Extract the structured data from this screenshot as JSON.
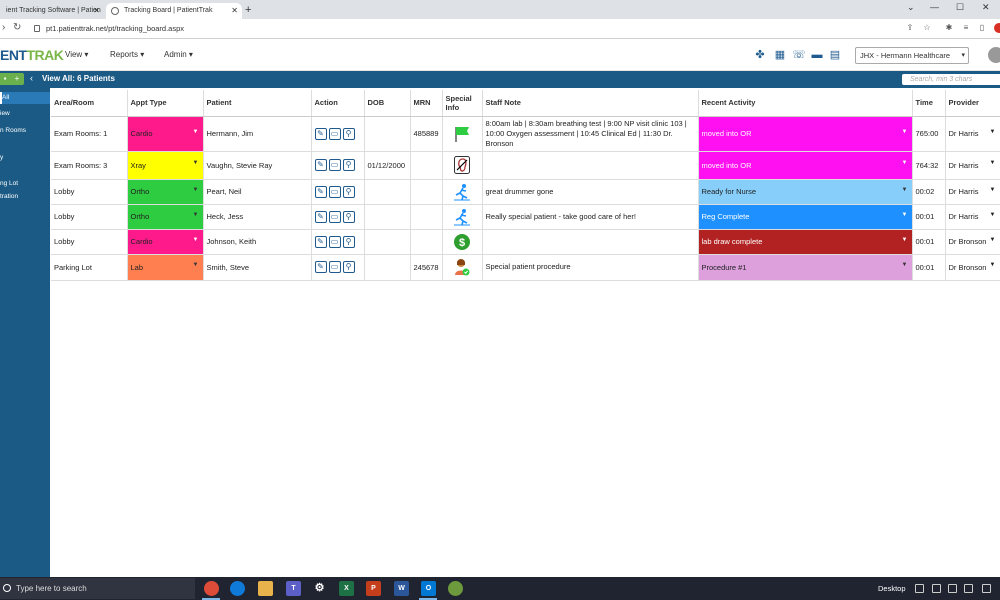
{
  "browser": {
    "tabs": [
      {
        "title": "ient Tracking Software | Patien"
      },
      {
        "title": "Tracking Board | PatientTrak"
      }
    ],
    "url": "pt1.patienttrak.net/pt/tracking_board.aspx"
  },
  "app": {
    "logo_main": "ENT",
    "logo_accent": "TRAK",
    "menu": [
      {
        "label": "View ▾"
      },
      {
        "label": "Reports ▾"
      },
      {
        "label": "Admin ▾"
      }
    ],
    "facility": "JHX - Hermann Healthcare",
    "title": "View All: 6 Patients",
    "search_placeholder": "Search, min 3 chars"
  },
  "sidebar": {
    "items": [
      {
        "label": "All"
      },
      {
        "label": "iew"
      },
      {
        "label": "n Rooms"
      },
      {
        "label": "y"
      },
      {
        "label": "ng Lot"
      },
      {
        "label": "tration"
      }
    ]
  },
  "table": {
    "columns": [
      "Area/Room",
      "Appt Type",
      "Patient",
      "Action",
      "DOB",
      "MRN",
      "Special Info",
      "Staff Note",
      "Recent Activity",
      "Time",
      "Provider"
    ],
    "rows": [
      {
        "area": "Exam Rooms: 1",
        "appt": "Cardio",
        "appt_color": "#ff1a8c",
        "patient": "Hermann, Jim",
        "dob": "",
        "mrn": "485889",
        "special": "flag-icon",
        "note": "8:00am lab | 8:30am breathing test | 9:00 NP visit clinic 103 | 10:00 Oxygen assessment | 10:45 Clinical Ed | 11:30 Dr. Bronson",
        "activity": "moved into OR",
        "activity_color": "#ff10f0",
        "time": "765:00",
        "provider": "Dr Harris"
      },
      {
        "area": "Exam Rooms: 3",
        "appt": "Xray",
        "appt_color": "#ffff00",
        "patient": "Vaughn, Stevie Ray",
        "dob": "01/12/2000",
        "mrn": "",
        "special": "ear-icon",
        "note": "",
        "activity": "moved into OR",
        "activity_color": "#ff10f0",
        "time": "764:32",
        "provider": "Dr Harris"
      },
      {
        "area": "Lobby",
        "appt": "Ortho",
        "appt_color": "#2ecc40",
        "patient": "Peart, Neil",
        "dob": "",
        "mrn": "",
        "special": "fall-risk-icon",
        "note": "great drummer gone",
        "activity": "Ready for Nurse",
        "activity_color": "#87cefa",
        "time": "00:02",
        "provider": "Dr Harris"
      },
      {
        "area": "Lobby",
        "appt": "Ortho",
        "appt_color": "#2ecc40",
        "patient": "Heck, Jess",
        "dob": "",
        "mrn": "",
        "special": "fall-risk-icon",
        "note": "Really special patient - take good care of her!",
        "activity": "Reg Complete",
        "activity_color": "#1e90ff",
        "time": "00:01",
        "provider": "Dr Harris"
      },
      {
        "area": "Lobby",
        "appt": "Cardio",
        "appt_color": "#ff1a8c",
        "patient": "Johnson, Keith",
        "dob": "",
        "mrn": "",
        "special": "dollar-icon",
        "note": "",
        "activity": "lab draw complete",
        "activity_color": "#b22222",
        "time": "00:01",
        "provider": "Dr Bronson"
      },
      {
        "area": "Parking Lot",
        "appt": "Lab",
        "appt_color": "#ff7f50",
        "patient": "Smith, Steve",
        "dob": "",
        "mrn": "245678",
        "special": "verified-person-icon",
        "note": "Special patient procedure",
        "activity": "Procedure #1",
        "activity_color": "#dda0dd",
        "time": "00:01",
        "provider": "Dr Bronson"
      }
    ]
  },
  "taskbar": {
    "search": "Type here to search",
    "desktop": "Desktop"
  }
}
